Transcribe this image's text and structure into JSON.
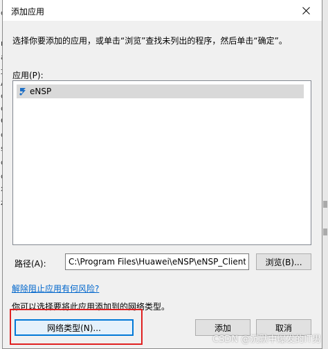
{
  "background": {
    "left_fragments": [
      "c",
      "re",
      "a",
      "攻",
      "A",
      "c",
      "c",
      "C",
      "c",
      "s",
      "c",
      "c",
      "x",
      "zi"
    ]
  },
  "dialog": {
    "title": "添加应用",
    "instruction": "选择你要添加的应用，或单击“浏览”查找未列出的程序，然后单击“确定”。",
    "apps_label": "应用(P):",
    "apps": [
      {
        "name": "eNSP",
        "icon": "ensp-app-icon"
      }
    ],
    "path_label": "路径(A):",
    "path_value": "C:\\Program Files\\Huawei\\eNSP\\eNSP_Client.exe",
    "browse_label": "浏览(B)...",
    "risk_link": "解除阻止应用有何风险?",
    "network_hint": "你可以选择要将此应用添加到的网络类型。",
    "network_type_label": "网络类型(N)...",
    "add_label": "添加",
    "cancel_label": "取消"
  },
  "watermark": "CSDN @沉默中爆发的IT男",
  "colors": {
    "highlight": "#e02020",
    "link": "#0066cc",
    "focus": "#0078d7",
    "ensp_icon": "#1f6fc5"
  }
}
